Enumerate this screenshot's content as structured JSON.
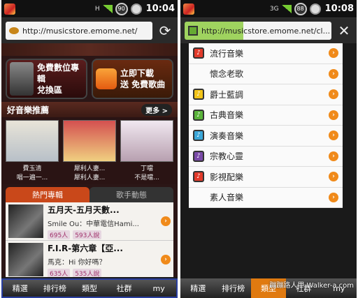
{
  "left": {
    "statusbar": {
      "network": "H",
      "battery": "90",
      "time": "10:04"
    },
    "url": "http://musicstore.emome.net/",
    "promos": [
      {
        "line1": "免費數位專輯",
        "line2": "兌換區"
      },
      {
        "line1": "立即下載",
        "line2": "送 免費歌曲"
      }
    ],
    "recommend": {
      "title": "好音樂推薦",
      "more": "更多 >",
      "items": [
        {
          "artist": "費玉清",
          "desc": "唱一遍一..."
        },
        {
          "artist": "犀利人妻...",
          "desc": "犀利人妻..."
        },
        {
          "artist": "丁噹",
          "desc": "不是噹..."
        }
      ]
    },
    "tabs": [
      "熱門專輯",
      "歌手動態"
    ],
    "albums": [
      {
        "title": "五月天-五月天數...",
        "sub": "Smile Ou：中華電信Hami...",
        "count1": "695人",
        "count2": "593人說"
      },
      {
        "title": "F.I.R-第六章【亞...",
        "sub": "馬克：Hi 你好嗎？",
        "count1": "635人",
        "count2": "535人說"
      }
    ],
    "nav": [
      "精選",
      "排行榜",
      "類型",
      "社群",
      "my"
    ]
  },
  "right": {
    "statusbar": {
      "network": "3G",
      "battery": "88",
      "time": "10:08"
    },
    "url": "http://musicstore.emome.net/cl...",
    "genres": [
      {
        "label": "流行音樂",
        "color": "#e23a2a"
      },
      {
        "label": "懷念老歌",
        "color": ""
      },
      {
        "label": "爵士藍調",
        "color": "#f2c418"
      },
      {
        "label": "古典音樂",
        "color": "#59b33a"
      },
      {
        "label": "演奏音樂",
        "color": "#3aa6d8"
      },
      {
        "label": "宗教心靈",
        "color": "#7a4aa8"
      },
      {
        "label": "影視配樂",
        "color": "#e23a2a"
      },
      {
        "label": "素人音樂",
        "color": ""
      }
    ],
    "nav": [
      "精選",
      "排行榜",
      "類型",
      "社群",
      "my"
    ],
    "watermark": "蹦蹦路人甲 Walker-a.com"
  }
}
